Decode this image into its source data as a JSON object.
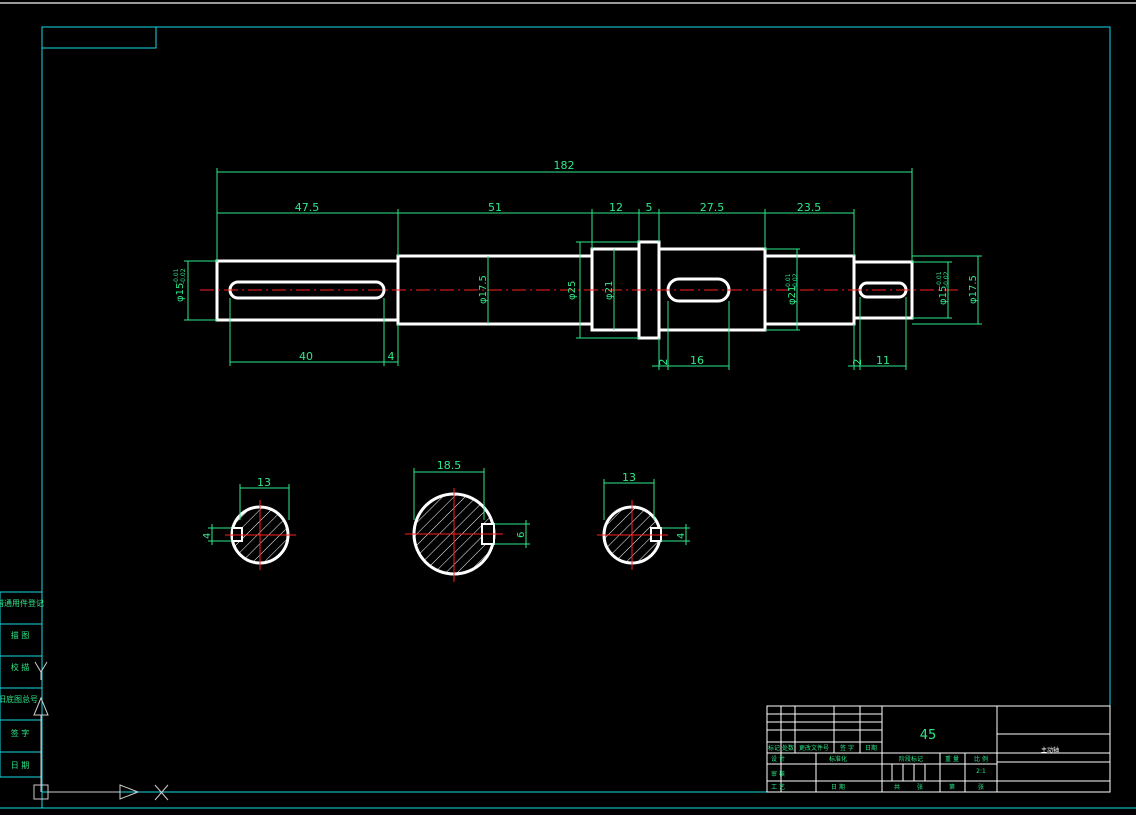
{
  "colors": {
    "background": "#000000",
    "frame": "#19d7e8",
    "outline": "#ffffff",
    "dimension": "#2ee88a",
    "centerline": "#ff2020",
    "hatch": "#ffffff"
  },
  "shaft": {
    "overall_length": "182",
    "segments": {
      "s1": "47.5",
      "s2": "51",
      "s3": "12",
      "s4": "5",
      "s5": "27.5",
      "s6": "23.5"
    },
    "keyway_lengths": {
      "left_key": "40",
      "left_offset": "4",
      "mid_offset": "2",
      "mid_key": "16",
      "right_offset": "2",
      "right_key": "11"
    },
    "diameters": {
      "d_left": "φ15",
      "d_left_tol_up": "-0.01",
      "d_left_tol_lo": "-0.02",
      "d_175a": "φ17.5",
      "d_25": "φ25",
      "d_21a": "φ21",
      "d_21b": "φ21",
      "d_21b_tol_up": "-0.01",
      "d_21b_tol_lo": "-0.02",
      "d_right": "φ15",
      "d_right_tol_up": "-0.01",
      "d_right_tol_lo": "-0.02",
      "d_175b": "φ17.5"
    }
  },
  "sections": {
    "left": {
      "width": "13",
      "key": "4"
    },
    "mid": {
      "width": "18.5",
      "key": "6"
    },
    "right": {
      "width": "13",
      "key": "4"
    }
  },
  "title_block": {
    "material": "45",
    "part_name": "主动轴",
    "row_labels": [
      "标记",
      "处数",
      "更改文件号",
      "签 字",
      "日期"
    ],
    "designer": "设 计",
    "standard": "标准化",
    "review": "审 核",
    "process": "工 艺",
    "approve": "日 期",
    "stage_mark": "阶段标记",
    "weight": "重 量",
    "scale": "比 例",
    "scale_value": "2:1",
    "total_sheets": "共",
    "sheet_word1": "张",
    "sheet_no": "第",
    "sheet_word2": "张"
  },
  "side_table": [
    "借通用件登记",
    "描 图",
    "校 描",
    "旧底图总号",
    "签 字",
    "日 期"
  ]
}
